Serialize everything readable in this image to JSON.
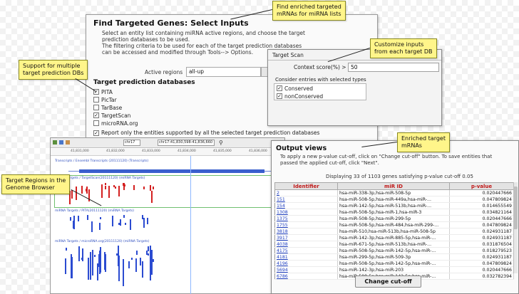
{
  "main_dialog": {
    "title": "Find Targeted Genes: Select Inputs",
    "description": [
      "Select an entity list containing miRNA active regions, and choose the target",
      "prediction databases to be used.",
      "The filtering criteria to be used for each of the target prediction databases",
      "can be accessed and modified through Tools--> Options."
    ],
    "active_regions_label": "Active regions",
    "active_regions_value": "all-up",
    "databases_heading": "Target prediction databases",
    "databases": [
      {
        "label": "PITA",
        "checked": true
      },
      {
        "label": "PicTar",
        "checked": false
      },
      {
        "label": "TarBase",
        "checked": false
      },
      {
        "label": "TargetScan",
        "checked": true
      },
      {
        "label": "microRNA.org",
        "checked": false
      }
    ],
    "report_option": "Report only the entities supported by all the selected target prediction databases",
    "report_checked": true
  },
  "target_scan": {
    "title": "Target Scan",
    "context_label": "Context score(%) >",
    "context_value": "50",
    "consider_label": "Consider entries with selected types",
    "types": [
      {
        "label": "Conserved",
        "checked": true
      },
      {
        "label": "nonConserved",
        "checked": true
      }
    ]
  },
  "genome_browser": {
    "chromosome": "chr17",
    "coordinates": "chr17:41,830,598-41,836,660",
    "ruler_ticks": [
      "41,831,000",
      "41,832,000",
      "41,833,000",
      "41,834,000",
      "41,835,000",
      "41,836,000"
    ],
    "tracks": [
      "Transcripts / Ensembl Transcripts (20111120) (Transcripts)",
      "miRNA Targets / TargetScan(20111120) (miRNA Targets)",
      "miRNA Targets / PITA(20111120) (miRNA Targets)",
      "miRNA Targets / microRNA.org(20111120) (miRNA Targets)"
    ]
  },
  "output_views": {
    "title": "Output views",
    "description": [
      "To apply a new p-value cut-off, click on \"Change cut-off\" button. To save entities that",
      "passed the applied cut-off, click \"Next\"."
    ],
    "displaying_text": "Displaying 33 of 1103 genes satisfying p-value cut-off 0.05",
    "columns": [
      "Identifier",
      "miR ID",
      "p-value"
    ],
    "rows": [
      [
        "2",
        "hsa-miR-338-3p,hsa-miR-508-5p",
        "0.020447666"
      ],
      [
        "151",
        "hsa-miR-508-5p,hsa-miR-449a,hsa-miR-...",
        "0.047809824"
      ],
      [
        "154",
        "hsa-miR-142-5p,hsa-miR-513b,hsa-miR-...",
        "0.014655549"
      ],
      [
        "1308",
        "hsa-miR-508-5p,hsa-miR-1,hsa-miR-3",
        "0.034821164"
      ],
      [
        "1375",
        "hsa-miR-508-5p,hsa-miR-299-5p",
        "0.020447666"
      ],
      [
        "1755",
        "hsa-miR-508-5p,hsa-miR-484,hsa-miR-299-...",
        "0.047809824"
      ],
      [
        "3818",
        "hsa-miR-510,hsa-miR-513b,hsa-miR-508-5p",
        "0.024931187"
      ],
      [
        "3917",
        "hsa-miR-142-3p,hsa-miR-885-5p,hsa-miR-...",
        "0.024931187"
      ],
      [
        "4038",
        "hsa-miR-671-5p,hsa-miR-513b,hsa-miR-...",
        "0.031876504"
      ],
      [
        "4175",
        "hsa-miR-508-5p,hsa-miR-142-5p,hsa-miR-...",
        "0.018279523"
      ],
      [
        "4181",
        "hsa-miR-299-5p,hsa-miR-509-3p",
        "0.024931187"
      ],
      [
        "4196",
        "hsa-miR-508-5p,hsa-miR-142-5p,hsa-miR-...",
        "0.047809824"
      ],
      [
        "5694",
        "hsa-miR-142-3p,hsa-miR-203",
        "0.020447666"
      ],
      [
        "6786",
        "hsa-miR-508-5p,hsa-miR-142-5p,hsa-miR-...",
        "0.032782394"
      ]
    ],
    "change_button": "Change cut-off"
  },
  "callouts": {
    "enriched_mrnas": [
      "Find enriched targeted",
      "mRNAs for miRNA lists"
    ],
    "multiple_dbs": [
      "Support for multiple",
      "target prediction DBs"
    ],
    "customize": [
      "Customize inputs",
      "from each target DB"
    ],
    "enriched_targets": [
      "Enriched target",
      "mRNAs"
    ],
    "target_regions": [
      "Target Regions in the",
      "Genome Browser"
    ]
  },
  "colors": {
    "callout": "#fff58a",
    "header_text": "#c01818",
    "link": "#2040c0",
    "mirna_red": "#d42020",
    "mirna_blue": "#2b4bd1"
  }
}
